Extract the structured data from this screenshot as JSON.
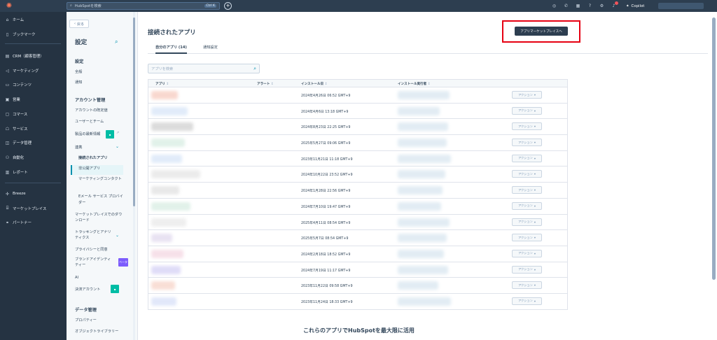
{
  "topbar": {
    "search_placeholder": "HubSpotを検索",
    "search_shortcut": "Ctrl K",
    "copilot_label": "Copilot",
    "badge_color": "#f2545b"
  },
  "leftnav": {
    "items": [
      {
        "label": "ホーム",
        "icon": "home-icon"
      },
      {
        "label": "ブックマーク",
        "icon": "bookmark-icon"
      },
      {
        "label": "CRM（顧客管理）",
        "icon": "crm-icon"
      },
      {
        "label": "マーケティング",
        "icon": "marketing-icon"
      },
      {
        "label": "コンテンツ",
        "icon": "content-icon"
      },
      {
        "label": "営業",
        "icon": "sales-icon"
      },
      {
        "label": "コマース",
        "icon": "commerce-icon"
      },
      {
        "label": "サービス",
        "icon": "service-icon"
      },
      {
        "label": "データ管理",
        "icon": "data-icon"
      },
      {
        "label": "自動化",
        "icon": "automation-icon"
      },
      {
        "label": "レポート",
        "icon": "report-icon"
      },
      {
        "label": "Breeze",
        "icon": "breeze-icon"
      },
      {
        "label": "マーケットプレイス",
        "icon": "marketplace-icon"
      },
      {
        "label": "パートナー",
        "icon": "partner-icon"
      }
    ]
  },
  "settings": {
    "back_label": "戻る",
    "title": "設定",
    "section_settings": "設定",
    "general": "全般",
    "notifications": "通知",
    "section_account": "アカウント管理",
    "account_defaults": "アカウントの既定値",
    "users_teams": "ユーザーとチーム",
    "product_updates": "製品の最新情報",
    "integrations": "連携",
    "connected_apps": "接続されたアプリ",
    "private_apps": "非公開アプリ",
    "marketing_contacts": "マーケティングコンタクト",
    "email_providers": "Eメール サービス プロバイダー",
    "marketplace_downloads": "マーケットプレイスでのダウンロード",
    "tracking_analytics": "トラッキングとアナリティクス",
    "privacy_consent": "プライバシーと同意",
    "brand_identity": "ブランドアイデンティティー",
    "ai": "AI",
    "billing": "決済アカウント",
    "section_data": "データ管理",
    "properties": "プロパティー",
    "object_library": "オブジェクトライブラリー",
    "new_badge_color": "#00bda5",
    "beta_badge": "ベータ",
    "beta_badge_color": "#7c5cfc"
  },
  "main": {
    "page_title": "接続されたアプリ",
    "marketplace_button": "アプリマーケットプレイスへ",
    "tabs": [
      "自分のアプリ (14)",
      "通知設定"
    ],
    "search_placeholder": "アプリを検索",
    "columns": [
      "アプリ",
      "アラート",
      "インストール日",
      "インストール実行者"
    ],
    "action_label": "アクション",
    "rows": [
      {
        "date": "2024年4月26日 06:52 GMT+9"
      },
      {
        "date": "2024年4月6日 13:18 GMT+9"
      },
      {
        "date": "2024年8月23日 22:25 GMT+9"
      },
      {
        "date": "2025年5月27日 09:06 GMT+9"
      },
      {
        "date": "2023年11月21日 11:18 GMT+9"
      },
      {
        "date": "2024年10月22日 23:52 GMT+9"
      },
      {
        "date": "2024年1月28日 22:56 GMT+9"
      },
      {
        "date": "2024年7月10日 19:47 GMT+9"
      },
      {
        "date": "2025年4月11日 08:54 GMT+9"
      },
      {
        "date": "2025年5月7日 08:54 GMT+9"
      },
      {
        "date": "2024年2月18日 18:52 GMT+9"
      },
      {
        "date": "2024年7月19日 11:17 GMT+9"
      },
      {
        "date": "2023年11月22日 09:58 GMT+9"
      },
      {
        "date": "2023年11月24日 18:33 GMT+9"
      }
    ],
    "bottom_heading": "これらのアプリでHubSpotを最大限に活用",
    "highlight_color": "#e60012"
  }
}
